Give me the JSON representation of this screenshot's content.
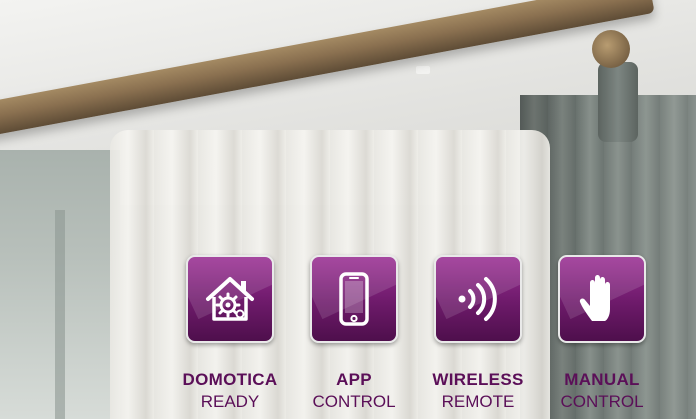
{
  "features": [
    {
      "icon": "smart-home-gear-icon",
      "title": "DOMOTICA",
      "subtitle": "READY"
    },
    {
      "icon": "smartphone-icon",
      "title": "APP",
      "subtitle": "CONTROL"
    },
    {
      "icon": "wireless-signal-icon",
      "title": "WIRELESS",
      "subtitle": "REMOTE"
    },
    {
      "icon": "hand-icon",
      "title": "MANUAL",
      "subtitle": "CONTROL"
    }
  ],
  "colors": {
    "brand_purple": "#6d1a6a",
    "label_purple": "#5b0f58",
    "rod_bronze": "#8a7050"
  }
}
